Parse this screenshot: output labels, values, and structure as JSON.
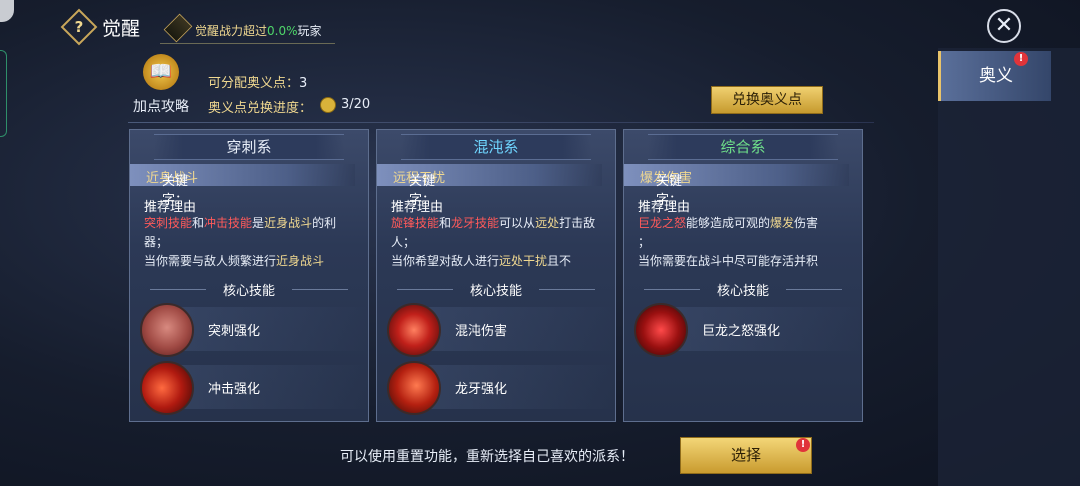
{
  "header": {
    "help_glyph": "?",
    "title": "觉醒",
    "awaken_prefix": "觉醒战力超过",
    "awaken_pct": "0.0%",
    "awaken_suffix": "玩家",
    "close_glyph": "✕"
  },
  "side": {
    "tab_label": "奥义",
    "tab_badge": "!"
  },
  "guide": {
    "book_glyph": "📖",
    "label": "加点攻略"
  },
  "points": {
    "label": "可分配奥义点：",
    "value": "3"
  },
  "progress": {
    "label": "奥义点兑换进度：",
    "value": "3/20"
  },
  "exchange_button": "兑换奥义点",
  "cards": [
    {
      "title": "穿刺系",
      "title_color": "#e8eef8",
      "keyword_label": "关键字：",
      "keyword_value": "近身战斗",
      "reason_title": "推荐理由",
      "reason_parts": [
        "突刺技能",
        "和",
        "冲击技能",
        "是",
        "近身战斗",
        "的利器；",
        "当你需要与敌人频繁进行",
        "近身战斗"
      ],
      "core_title": "核心技能",
      "skills": [
        {
          "name": "突刺强化",
          "icon": "thrust-icon"
        },
        {
          "name": "冲击强化",
          "icon": "impact-icon"
        }
      ]
    },
    {
      "title": "混沌系",
      "title_color": "#6fd6ff",
      "keyword_label": "关键字：",
      "keyword_value": "远程干扰",
      "reason_title": "推荐理由",
      "reason_parts": [
        "旋锋技能",
        "和",
        "龙牙技能",
        "可以从",
        "远处",
        "打击敌人；",
        "当你希望对敌人进行",
        "远处干扰",
        "且不"
      ],
      "core_title": "核心技能",
      "skills": [
        {
          "name": "混沌伤害",
          "icon": "chaos-icon"
        },
        {
          "name": "龙牙强化",
          "icon": "dragon-fang-icon"
        }
      ]
    },
    {
      "title": "综合系",
      "title_color": "#6fe08a",
      "keyword_label": "关键字：",
      "keyword_value": "爆发伤害",
      "reason_title": "推荐理由",
      "reason_parts": [
        "巨龙之怒",
        "能够造成可观的",
        "爆发",
        "伤害",
        "；",
        "当你需要在战斗中尽可能存活并积"
      ],
      "core_title": "核心技能",
      "skills": [
        {
          "name": "巨龙之怒强化",
          "icon": "dragon-rage-icon"
        }
      ]
    }
  ],
  "footer": {
    "hint": "可以使用重置功能，重新选择自己喜欢的派系！",
    "select_button": "选择",
    "select_badge": "!"
  }
}
